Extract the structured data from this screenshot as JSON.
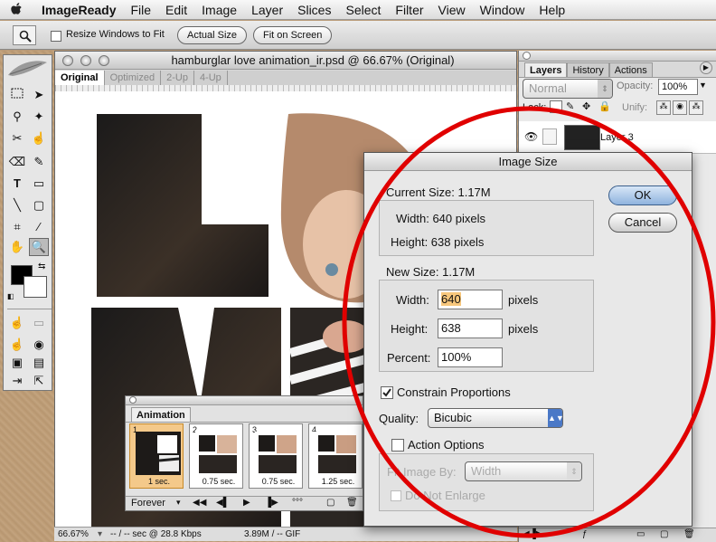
{
  "menubar": {
    "app": "ImageReady",
    "items": [
      "File",
      "Edit",
      "Image",
      "Layer",
      "Slices",
      "Select",
      "Filter",
      "View",
      "Window",
      "Help"
    ]
  },
  "options": {
    "resize_label": "Resize Windows to Fit",
    "actual_size": "Actual Size",
    "fit_on_screen": "Fit on Screen"
  },
  "document": {
    "title": "hamburglar love animation_ir.psd @ 66.67% (Original)",
    "tabs": [
      "Original",
      "Optimized",
      "2-Up",
      "4-Up"
    ],
    "status": {
      "zoom": "66.67%",
      "speed": "-- / -- sec @ 28.8 Kbps",
      "size": "3.89M / -- GIF"
    }
  },
  "layers": {
    "tabs": [
      "Layers",
      "History",
      "Actions"
    ],
    "blend_mode": "Normal",
    "opacity_label": "Opacity:",
    "opacity_value": "100%",
    "lock_label": "Lock:",
    "unify_label": "Unify:",
    "layer_name": "Layer 3"
  },
  "animation": {
    "title": "Animation",
    "frames": [
      {
        "num": "1",
        "delay": "1 sec."
      },
      {
        "num": "2",
        "delay": "0.75 sec."
      },
      {
        "num": "3",
        "delay": "0.75 sec."
      },
      {
        "num": "4",
        "delay": "1.25 sec."
      }
    ],
    "loop": "Forever"
  },
  "dialog": {
    "title": "Image Size",
    "current_size_label": "Current Size: 1.17M",
    "current_width": "Width: 640 pixels",
    "current_height": "Height: 638 pixels",
    "new_size_label": "New Size: 1.17M",
    "width_label": "Width:",
    "width_value": "640",
    "width_unit": "pixels",
    "height_label": "Height:",
    "height_value": "638",
    "height_unit": "pixels",
    "percent_label": "Percent:",
    "percent_value": "100%",
    "constrain_label": "Constrain Proportions",
    "quality_label": "Quality:",
    "quality_value": "Bicubic",
    "action_options_label": "Action Options",
    "fit_image_by_label": "Fit Image By:",
    "fit_image_by_value": "Width",
    "do_not_enlarge_label": "Do Not Enlarge",
    "ok": "OK",
    "cancel": "Cancel"
  },
  "colors": {
    "annotation": "#e00000",
    "default_button": "#8fb3de",
    "selected_frame": "#f4c98a"
  }
}
